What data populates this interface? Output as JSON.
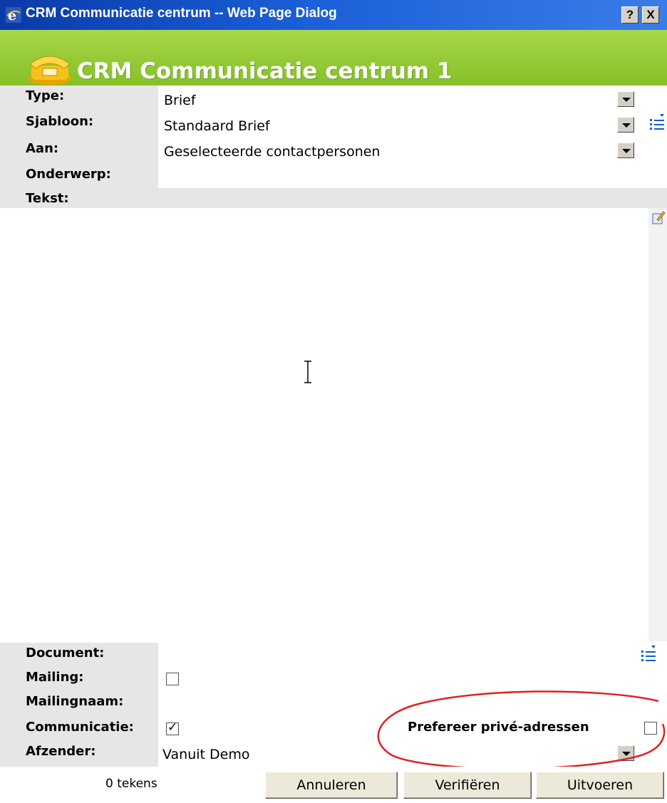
{
  "window": {
    "title": "CRM Communicatie centrum -- Web Page Dialog",
    "help_btn": "?",
    "close_btn": "X"
  },
  "banner": {
    "heading": "CRM Communicatie centrum 1",
    "icon": "fax-phone-icon"
  },
  "form": {
    "type_label": "Type:",
    "type_value": "Brief",
    "sjabloon_label": "Sjabloon:",
    "sjabloon_value": "Standaard Brief",
    "aan_label": "Aan:",
    "aan_value": "Geselecteerde contactpersonen",
    "onderwerp_label": "Onderwerp:",
    "onderwerp_value": "",
    "tekst_label": "Tekst:",
    "tekst_value": "",
    "document_label": "Document:",
    "document_value": "",
    "mailing_label": "Mailing:",
    "mailing_checked": false,
    "mailingnaam_label": "Mailingnaam:",
    "mailingnaam_value": "",
    "communicatie_label": "Communicatie:",
    "communicatie_checked": true,
    "prefereer_label": "Prefereer privé-adressen",
    "prefereer_checked": false,
    "afzender_label": "Afzender:",
    "afzender_value": "Vanuit Demo"
  },
  "footer": {
    "char_count": "0 tekens",
    "cancel_label": "Annuleren",
    "verify_label": "Verifiëren",
    "execute_label": "Uitvoeren"
  },
  "colors": {
    "titlebar": "#1a5fd8",
    "banner_green": "#98cc3a",
    "annotation_red": "#e02020"
  }
}
